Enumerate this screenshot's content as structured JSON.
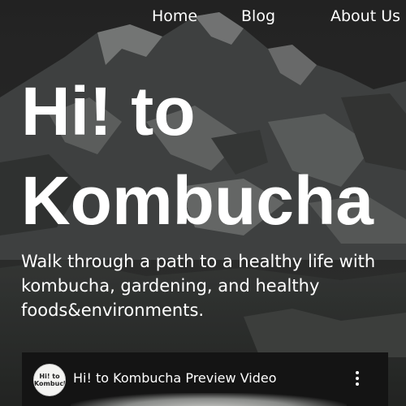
{
  "nav": {
    "items": [
      {
        "label": "Home"
      },
      {
        "label": "Blog"
      },
      {
        "label": "About Us"
      }
    ]
  },
  "hero": {
    "title": "Hi! to Kombucha",
    "subtitle": "Walk through a path to a healthy life with kombucha, gardening, and healthy foods&environments."
  },
  "video": {
    "title": "Hi! to Kombucha Preview Video",
    "channel_avatar_text": "Hi! to Kombucha",
    "menu_icon": "more-vert-icon"
  },
  "colors": {
    "text": "#ffffff",
    "overlay": "#2b2d2e",
    "video_bg": "#141414"
  }
}
